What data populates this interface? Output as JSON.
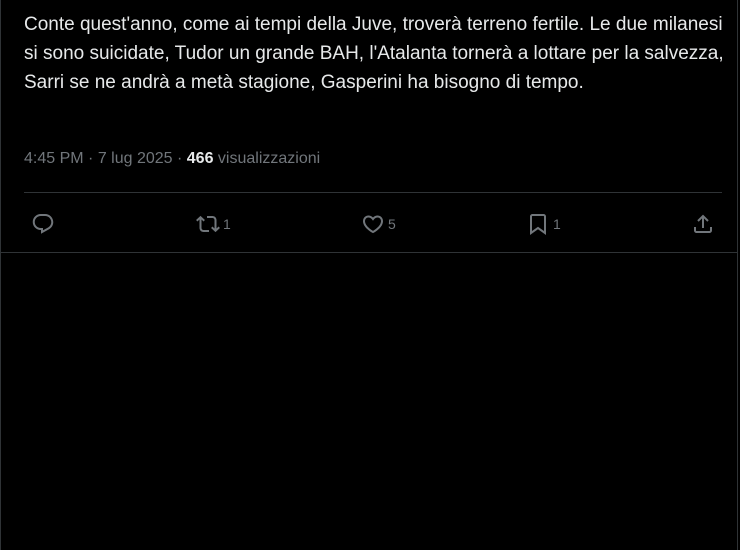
{
  "tweet": {
    "text": "Conte quest'anno, come ai tempi della Juve, troverà terreno fertile. Le due milanesi si sono suicidate, Tudor un grande BAH, l'Atalanta tornerà a lottare per la salvezza, Sarri se ne andrà a metà stagione, Gasperini ha bisogno di tempo.",
    "time": "4:45 PM",
    "separator1": " · ",
    "date": "7 lug 2025",
    "separator2": " · ",
    "views_count": "466",
    "views_label": " visualizzazioni"
  },
  "actions": {
    "reply": {
      "icon": "reply-icon",
      "count": ""
    },
    "repost": {
      "icon": "repost-icon",
      "count": "1"
    },
    "like": {
      "icon": "heart-icon",
      "count": "5"
    },
    "bookmark": {
      "icon": "bookmark-icon",
      "count": "1"
    },
    "share": {
      "icon": "share-icon",
      "count": ""
    }
  },
  "colors": {
    "background": "#000000",
    "text": "#e7e9ea",
    "secondary_text": "#71767b",
    "border": "#2f3336"
  }
}
